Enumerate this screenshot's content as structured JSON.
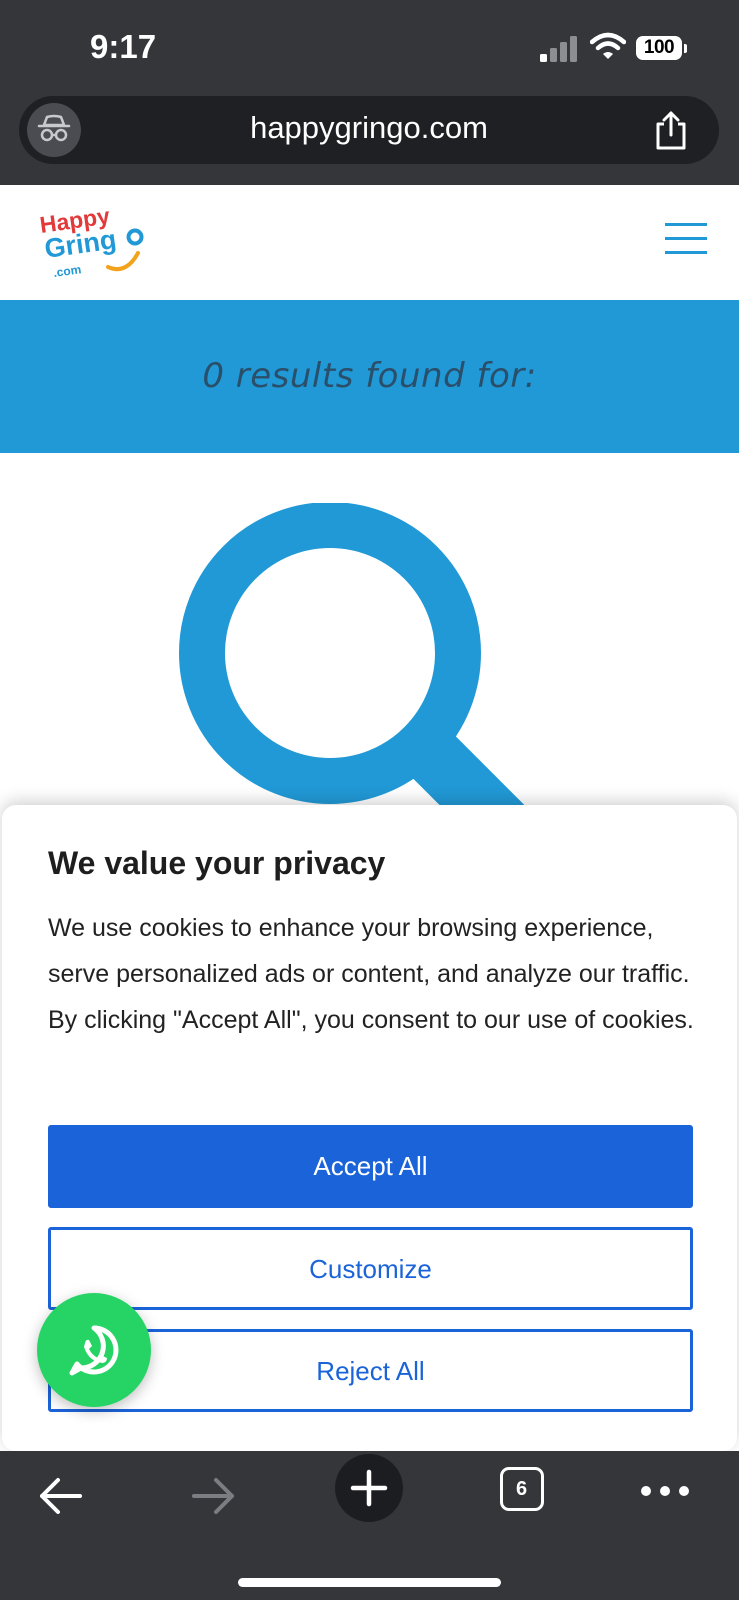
{
  "status_bar": {
    "time": "9:17",
    "battery": "100",
    "icons": [
      "cellular-signal-icon",
      "wifi-icon",
      "battery-icon"
    ]
  },
  "browser": {
    "url": "happygringo.com",
    "incognito_icon": "incognito-icon",
    "share_icon": "share-icon",
    "tab_count": "6",
    "toolbar_icons": [
      "back-arrow-icon",
      "forward-arrow-icon",
      "plus-icon",
      "tabs-icon",
      "more-icon"
    ]
  },
  "site": {
    "logo_text": [
      "Happy",
      "Gringo",
      ".com"
    ],
    "hero_text": "0 results found for:",
    "colors": {
      "brand_blue": "#2199d6",
      "accent_red": "#e23a3a"
    }
  },
  "cookie_banner": {
    "title": "We value your privacy",
    "body": "We use cookies to enhance your browsing experience, serve personalized ads or content, and analyze our traffic. By clicking \"Accept All\", you consent to our use of cookies.",
    "accept_label": "Accept All",
    "customize_label": "Customize",
    "reject_label": "Reject All",
    "colors": {
      "primary": "#1b63d8"
    }
  },
  "whatsapp": {
    "icon": "whatsapp-icon",
    "color": "#26d365"
  }
}
